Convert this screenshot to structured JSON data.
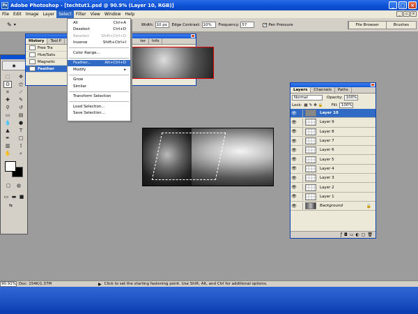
{
  "window": {
    "title": "Adobe Photoshop - [techtut1.psd @ 90.9% (Layer 10, RGB)]",
    "min": "_",
    "max": "□",
    "close": "×"
  },
  "menubar": {
    "items": [
      "File",
      "Edit",
      "Image",
      "Layer",
      "Select",
      "Filter",
      "View",
      "Window",
      "Help"
    ]
  },
  "options": {
    "width_label": "Width:",
    "width_value": "10 px",
    "edge_label": "Edge Contrast:",
    "edge_value": "10%",
    "freq_label": "Frequency:",
    "freq_value": "57",
    "pen_label": "Pen Pressure",
    "well_tabs": [
      "File Browser",
      "Brushes"
    ]
  },
  "select_menu": {
    "items": [
      {
        "label": "All",
        "shortcut": "Ctrl+A",
        "state": "normal"
      },
      {
        "label": "Deselect",
        "shortcut": "Ctrl+D",
        "state": "normal"
      },
      {
        "label": "Reselect",
        "shortcut": "Shift+Ctrl+D",
        "state": "disabled"
      },
      {
        "label": "Inverse",
        "shortcut": "Shift+Ctrl+I",
        "state": "normal"
      },
      {
        "label": "Color Range...",
        "shortcut": "",
        "state": "normal"
      },
      {
        "label": "Feather...",
        "shortcut": "Alt+Ctrl+D",
        "state": "highlighted"
      },
      {
        "label": "Modify",
        "shortcut": "▸",
        "state": "normal"
      },
      {
        "label": "Grow",
        "shortcut": "",
        "state": "normal"
      },
      {
        "label": "Similar",
        "shortcut": "",
        "state": "normal"
      },
      {
        "label": "Transform Selection",
        "shortcut": "",
        "state": "normal"
      },
      {
        "label": "Load Selection...",
        "shortcut": "",
        "state": "normal"
      },
      {
        "label": "Save Selection...",
        "shortcut": "",
        "state": "normal"
      }
    ]
  },
  "history": {
    "tabs": [
      "History",
      "Tool P",
      "ter",
      "Info"
    ],
    "rows": [
      "Free Tra",
      "Hue/Satu",
      "Magnetic",
      "Feather"
    ]
  },
  "layers": {
    "tabs": [
      "Layers",
      "Channels",
      "Paths"
    ],
    "blend": "Normal",
    "opacity_label": "Opacity:",
    "opacity": "100%",
    "lock_label": "Lock:",
    "fill_label": "Fill:",
    "fill": "100%",
    "rows": [
      "Layer 10",
      "Layer 9",
      "Layer 8",
      "Layer 7",
      "Layer 6",
      "Layer 5",
      "Layer 4",
      "Layer 3",
      "Layer 2",
      "Layer 1",
      "Background"
    ]
  },
  "status": {
    "zoom": "90.91%",
    "doc": "Doc: 154K/1.37M",
    "hint": "Click to set the starting fastening point.  Use Shift, Alt, and Ctrl for additional options."
  }
}
